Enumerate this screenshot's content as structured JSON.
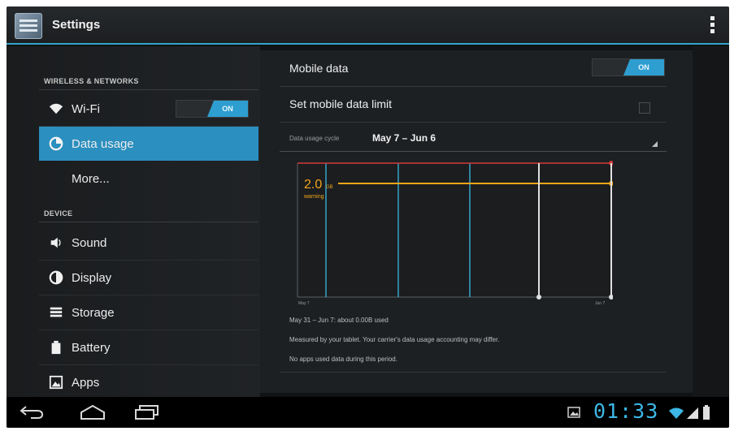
{
  "actionbar": {
    "title": "Settings"
  },
  "sidebar": {
    "sections": [
      {
        "header": "WIRELESS & NETWORKS"
      },
      {
        "header": "DEVICE"
      }
    ],
    "items": [
      {
        "label": "Wi-Fi",
        "icon": "wifi-icon",
        "toggle": "ON"
      },
      {
        "label": "Data usage",
        "icon": "data-usage-icon"
      },
      {
        "label": "More..."
      },
      {
        "label": "Sound",
        "icon": "speaker-icon"
      },
      {
        "label": "Display",
        "icon": "brightness-icon"
      },
      {
        "label": "Storage",
        "icon": "storage-icon"
      },
      {
        "label": "Battery",
        "icon": "battery-icon"
      },
      {
        "label": "Apps",
        "icon": "apps-icon"
      }
    ],
    "accent": "#2b8fbf"
  },
  "detail": {
    "mobile_data": {
      "label": "Mobile data",
      "toggle": "ON"
    },
    "limit": {
      "label": "Set mobile data limit"
    },
    "cycle": {
      "label": "Data usage cycle",
      "value": "May 7 – Jun 6"
    },
    "chart": {
      "warning_value": "2.0",
      "warning_unit": "GB",
      "warning_label": "warning",
      "x_start": "May 7",
      "x_end": "Jun 7"
    },
    "notes": [
      "May 31 – Jun 7: about 0.00B used",
      "Measured by your tablet. Your carrier's data usage accounting may differ.",
      "No apps used data during this period."
    ]
  },
  "statusbar": {
    "time": "01:33"
  }
}
